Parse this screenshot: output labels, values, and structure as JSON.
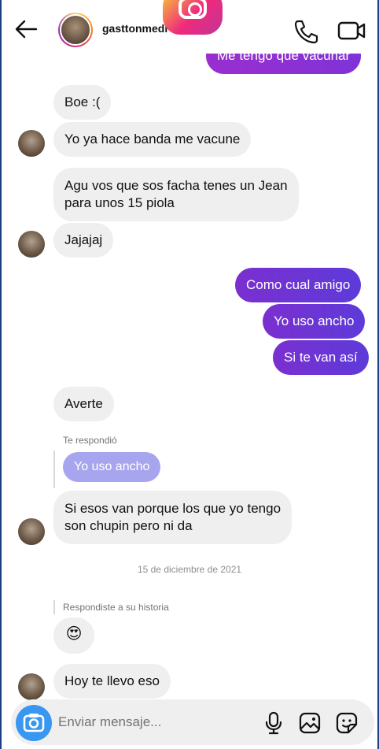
{
  "header": {
    "username": "gasttonmedi"
  },
  "messages": {
    "m0": "Me tengo que vacunar",
    "m1": "Boe :(",
    "m2": "Yo ya hace banda me vacune",
    "m3_l1": "Agu vos que sos facha tenes un Jean",
    "m3_l2": "para unos 15 piola",
    "m4": "Jajajaj",
    "m5": "Como cual amigo",
    "m6": "Yo uso ancho",
    "m7": "Si te van así",
    "m8": "Averte",
    "m9_caption": "Te respondió",
    "m9_quote": "Yo uso ancho",
    "m9_l1": "Si esos van porque los que yo tengo",
    "m9_l2": "son chupin pero ni da",
    "date": "15 de diciembre de 2021",
    "m10_caption": "Respondiste a su historia",
    "m10": "😍",
    "m11": "Hoy te llevo eso"
  },
  "composer": {
    "placeholder": "Enviar mensaje..."
  },
  "colors": {
    "accent_blue": "#3897f0",
    "outgoing_start": "#7b2fd0",
    "outgoing_end": "#5d3bd9",
    "incoming_bg": "#efefef",
    "quoted_bg": "#a6a5ee"
  },
  "icons": [
    "back-arrow-icon",
    "instagram-logo-icon",
    "phone-icon",
    "video-camera-icon",
    "camera-icon",
    "microphone-icon",
    "gallery-icon",
    "sticker-icon"
  ]
}
